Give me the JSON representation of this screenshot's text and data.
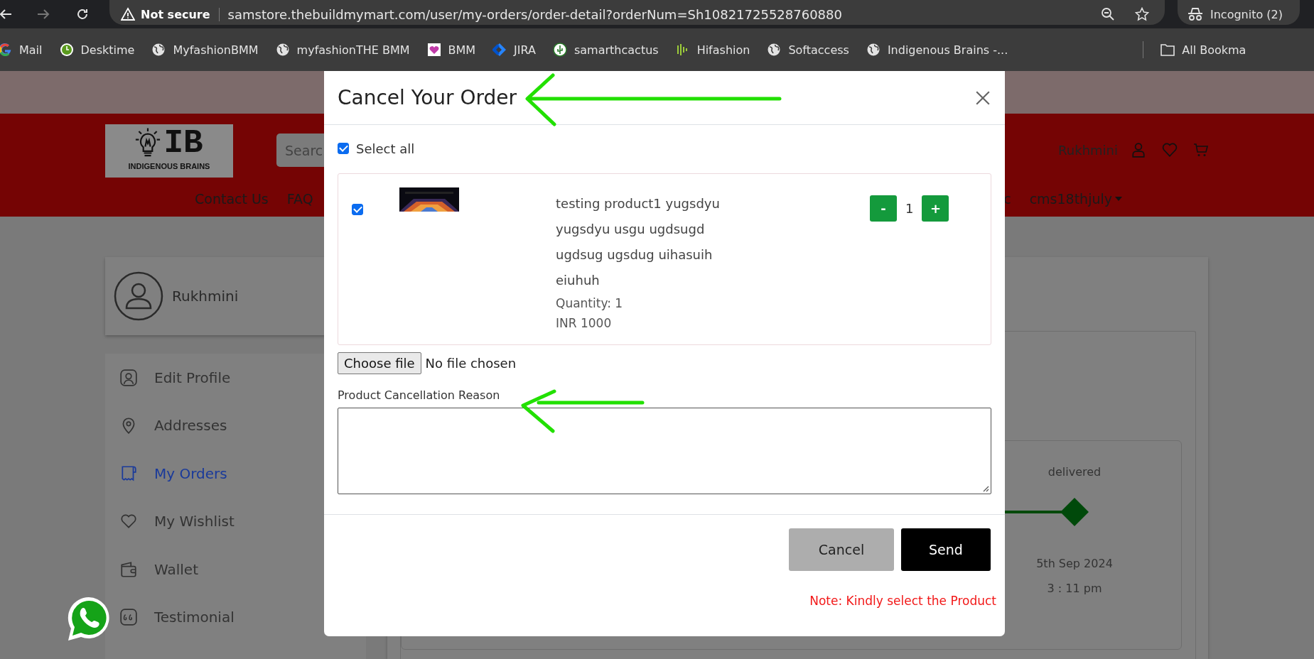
{
  "browser": {
    "security_label": "Not secure",
    "url": "samstore.thebuildmymart.com/user/my-orders/order-detail?orderNum=Sh10821725528760880",
    "incognito": "Incognito (2)",
    "bookmarks": [
      {
        "label": "Mail",
        "kind": "google"
      },
      {
        "label": "Desktime",
        "kind": "desktime"
      },
      {
        "label": "MyfashionBMM",
        "kind": "globe"
      },
      {
        "label": "myfashionTHE BMM",
        "kind": "globe"
      },
      {
        "label": "BMM",
        "kind": "bmm"
      },
      {
        "label": "JIRA",
        "kind": "jira"
      },
      {
        "label": "samarthcactus",
        "kind": "cactus"
      },
      {
        "label": "Hifashion",
        "kind": "bars"
      },
      {
        "label": "Softaccess",
        "kind": "globe"
      },
      {
        "label": "Indigenous Brains -...",
        "kind": "globe"
      }
    ],
    "all_bookmarks": "All Bookma"
  },
  "site_header": {
    "logo_title": "IB",
    "logo_subtitle": "INDIGENOUS BRAINS",
    "search_placeholder": "Searc",
    "user_name": "Rukhmini",
    "nav_left": [
      "Contact Us",
      "FAQ"
    ],
    "nav_right": [
      {
        "label": "c",
        "dropdown": false
      },
      {
        "label": "cms18thjuly",
        "dropdown": true
      }
    ]
  },
  "profile": {
    "name": "Rukhmini"
  },
  "account_menu": [
    {
      "label": "Edit Profile",
      "kind": "profile",
      "selected": false
    },
    {
      "label": "Addresses",
      "kind": "pin",
      "selected": false
    },
    {
      "label": "My Orders",
      "kind": "receipt",
      "selected": true
    },
    {
      "label": "My Wishlist",
      "kind": "heart",
      "selected": false
    },
    {
      "label": "Wallet",
      "kind": "wallet",
      "selected": false
    },
    {
      "label": "Testimonial",
      "kind": "quote",
      "selected": false
    }
  ],
  "order_status": {
    "step": "delivered",
    "date": "5th Sep 2024",
    "time": "3 : 11 pm"
  },
  "modal": {
    "title": "Cancel Your Order",
    "select_all": {
      "label": "Select all",
      "checked": true
    },
    "items": [
      {
        "checked": true,
        "name": "testing product1 yugsdyu yugsdyu usgu ugdsugd ugdsug ugsdug uihasuih eiuhuh",
        "quantity": "Quantity: 1",
        "price": "INR 1000",
        "minus": "-",
        "count": "1",
        "plus": "+"
      }
    ],
    "file_button": "Choose file",
    "file_status": "No file chosen",
    "reason_label": "Product Cancellation Reason",
    "cancel_button": "Cancel",
    "send_button": "Send",
    "note": "Note: Kindly select the Product"
  }
}
